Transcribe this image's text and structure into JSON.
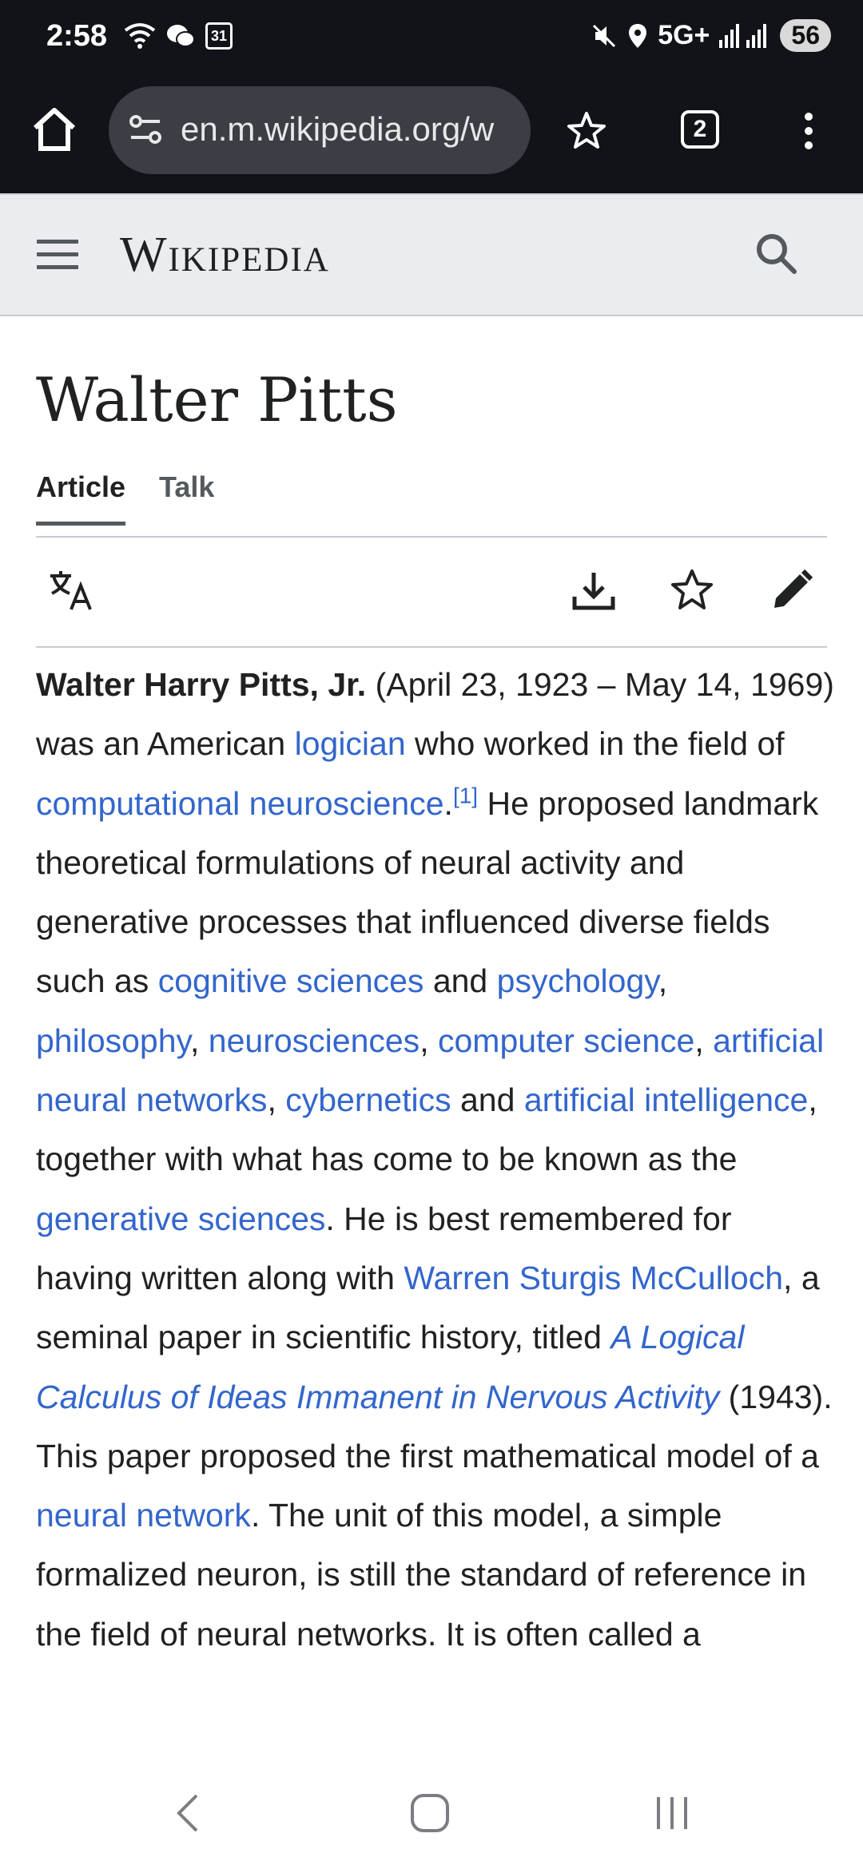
{
  "status_bar": {
    "time": "2:58",
    "calendar_day": "31",
    "network": "5G+",
    "battery": "56",
    "icons": [
      "wifi-icon",
      "wechat-icon",
      "calendar-icon",
      "mute-icon",
      "location-icon",
      "signal-icon"
    ]
  },
  "browser": {
    "url": "en.m.wikipedia.org/w",
    "tab_count": "2"
  },
  "header": {
    "wordmark": "Wikipedia"
  },
  "page": {
    "title": "Walter Pitts",
    "tabs": [
      {
        "label": "Article",
        "active": true
      },
      {
        "label": "Talk",
        "active": false
      }
    ]
  },
  "article": {
    "segments": [
      {
        "t": "Walter Harry Pitts, Jr.",
        "s": "b"
      },
      {
        "t": " (April 23, 1923 – May 14, 1969) was an American "
      },
      {
        "t": "logician",
        "s": "a"
      },
      {
        "t": " who worked in the field of "
      },
      {
        "t": "computational neuroscience",
        "s": "a"
      },
      {
        "t": "."
      },
      {
        "t": "[1]",
        "s": "sup"
      },
      {
        "t": " He proposed landmark theoretical formulations of neural activity and generative processes that influenced diverse fields such as "
      },
      {
        "t": "cognitive sciences",
        "s": "a"
      },
      {
        "t": " and "
      },
      {
        "t": "psychology",
        "s": "a"
      },
      {
        "t": ", "
      },
      {
        "t": "philosophy",
        "s": "a"
      },
      {
        "t": ", "
      },
      {
        "t": "neurosciences",
        "s": "a"
      },
      {
        "t": ", "
      },
      {
        "t": "computer science",
        "s": "a"
      },
      {
        "t": ", "
      },
      {
        "t": "artificial neural networks",
        "s": "a"
      },
      {
        "t": ", "
      },
      {
        "t": "cybernetics",
        "s": "a"
      },
      {
        "t": " and "
      },
      {
        "t": "artificial intelligence",
        "s": "a"
      },
      {
        "t": ", together with what has come to be known as the "
      },
      {
        "t": "generative sciences",
        "s": "a"
      },
      {
        "t": ". He is best remembered for having written along with "
      },
      {
        "t": "Warren Sturgis McCulloch",
        "s": "a"
      },
      {
        "t": ", a seminal paper in scientific history, titled "
      },
      {
        "t": "A Logical Calculus of Ideas Immanent in Nervous Activity",
        "s": "ai"
      },
      {
        "t": " (1943). This paper proposed the first mathematical model of a "
      },
      {
        "t": "neural network",
        "s": "a"
      },
      {
        "t": ". The unit of this model, a simple formalized neuron, is still the standard of reference in the field of neural networks. It is often called a"
      }
    ]
  },
  "colors": {
    "link": "#3366cc",
    "text": "#202122",
    "chrome_bg": "#111318",
    "header_bg": "#eaecf0"
  }
}
